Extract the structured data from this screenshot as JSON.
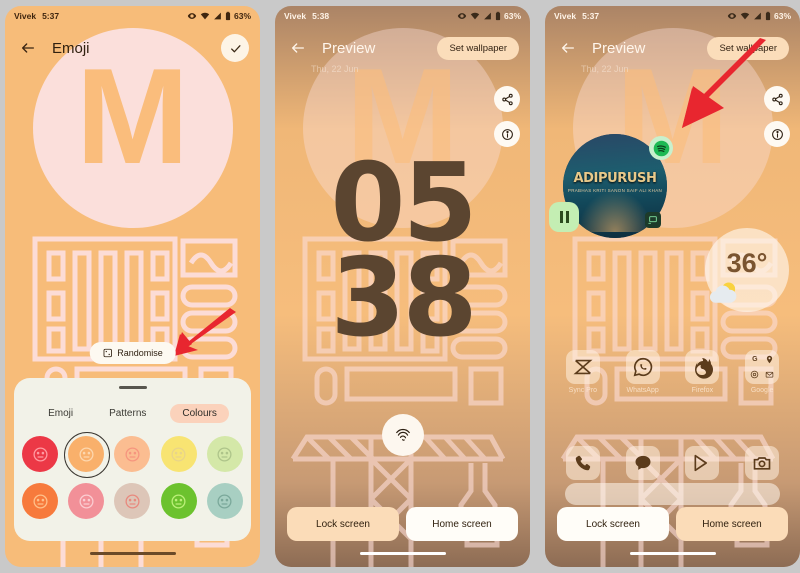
{
  "panels": [
    {
      "id": "emoji-editor",
      "statusbar": {
        "carrier": "Vivek",
        "time": "5:37",
        "battery": "63%"
      },
      "appbar": {
        "back_icon": "arrow-left-icon",
        "title": "Emoji",
        "confirm_icon": "check-icon"
      },
      "wallpaper": {
        "letter": "M",
        "pattern": "city-buildings-pattern",
        "bg_color": "#f7bc79",
        "circle_color": "#fbdfdb"
      },
      "randomise": {
        "label": "Randomise",
        "icon": "dice-icon"
      },
      "sheet": {
        "tabs": [
          {
            "label": "Emoji",
            "active": false
          },
          {
            "label": "Patterns",
            "active": false
          },
          {
            "label": "Colours",
            "active": true
          }
        ],
        "swatches": [
          {
            "color": "#ec3846",
            "face": "#ff9aa2",
            "selected": false
          },
          {
            "color": "#f9b06b",
            "face": "#fdd7ae",
            "selected": true
          },
          {
            "color": "#fbbd91",
            "face": "#f6957e",
            "selected": false
          },
          {
            "color": "#f8e472",
            "face": "#e8d48a",
            "selected": false
          },
          {
            "color": "#d4e8a8",
            "face": "#aec48a",
            "selected": false
          },
          {
            "color": "#f77a3c",
            "face": "#ffc08a",
            "selected": false
          },
          {
            "color": "#f29098",
            "face": "#fbcdd2",
            "selected": false
          },
          {
            "color": "#ddc6b8",
            "face": "#e8897e",
            "selected": false
          },
          {
            "color": "#6cc22e",
            "face": "#bdf07a",
            "selected": false
          },
          {
            "color": "#a8cfc2",
            "face": "#7aa89a",
            "selected": false
          }
        ]
      }
    },
    {
      "id": "preview-lock-screen",
      "statusbar": {
        "carrier": "Vivek",
        "time": "5:38",
        "battery": "63%"
      },
      "appbar": {
        "back_icon": "arrow-left-icon",
        "title": "Preview",
        "action_label": "Set wallpaper"
      },
      "date": "Thu, 22 Jun",
      "clock": {
        "hours": "05",
        "minutes": "38"
      },
      "fabs": [
        "share-icon",
        "info-icon"
      ],
      "fingerprint_icon": "fingerprint-icon",
      "bottom_toggle": [
        {
          "label": "Lock screen",
          "active": true
        },
        {
          "label": "Home screen",
          "active": false
        }
      ]
    },
    {
      "id": "preview-home-screen",
      "statusbar": {
        "carrier": "Vivek",
        "time": "5:37",
        "battery": "63%"
      },
      "appbar": {
        "back_icon": "arrow-left-icon",
        "title": "Preview",
        "action_label": "Set wallpaper"
      },
      "date": "Thu, 22 Jun",
      "fabs": [
        "share-icon",
        "info-icon"
      ],
      "media": {
        "album_title": "ADIPURUSH",
        "album_sub": "PRABHAS  KRITI SANON  SAIF ALI KHAN",
        "provider_icon": "spotify-icon",
        "pause_icon": "pause-icon",
        "cast_icon": "cast-icon"
      },
      "weather": {
        "temperature": "36°",
        "icon": "partly-cloudy-icon"
      },
      "apps_row1": [
        {
          "label": "Sync Pro",
          "icon": "sync-pro-icon"
        },
        {
          "label": "WhatsApp",
          "icon": "whatsapp-icon"
        },
        {
          "label": "Firefox",
          "icon": "firefox-icon"
        },
        {
          "label": "Google",
          "icon": "google-folder-icon"
        }
      ],
      "dock": [
        {
          "icon": "phone-icon"
        },
        {
          "icon": "messages-icon"
        },
        {
          "icon": "play-store-icon"
        },
        {
          "icon": "camera-icon"
        }
      ],
      "bottom_toggle": [
        {
          "label": "Lock screen",
          "active": false
        },
        {
          "label": "Home screen",
          "active": true
        }
      ]
    }
  ],
  "annotations": {
    "arrow_color": "#e8262f",
    "arrow1_target": "randomise-chip",
    "arrow2_target": "set-wallpaper-button"
  }
}
